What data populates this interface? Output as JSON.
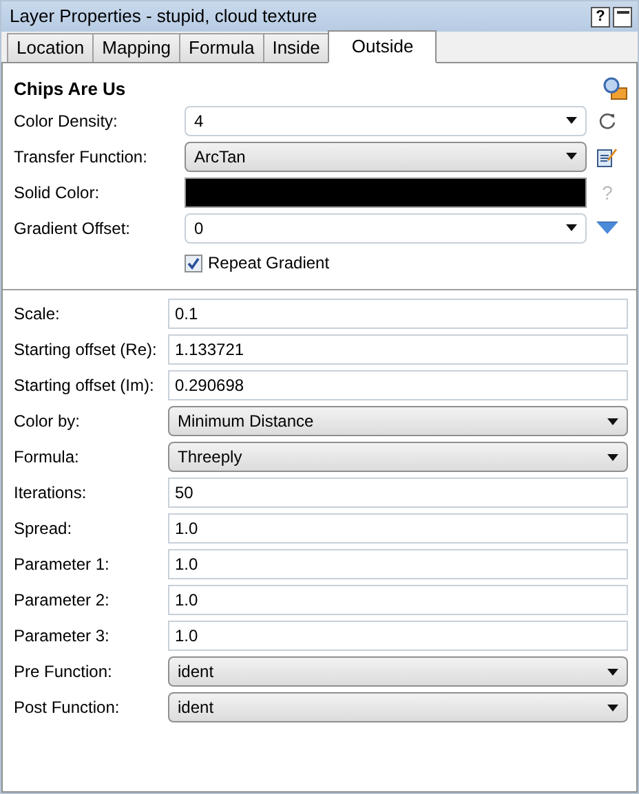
{
  "window": {
    "title": "Layer Properties - stupid, cloud texture",
    "help_button": "?"
  },
  "tabs": [
    {
      "label": "Location",
      "selected": false
    },
    {
      "label": "Mapping",
      "selected": false
    },
    {
      "label": "Formula",
      "selected": false
    },
    {
      "label": "Inside",
      "selected": false
    },
    {
      "label": "Outside",
      "selected": true
    }
  ],
  "section": {
    "title": "Chips Are Us"
  },
  "top_fields": [
    {
      "label": "Color Density:",
      "kind": "combo",
      "value": "4",
      "side_button": {
        "kind": "reset"
      }
    },
    {
      "label": "Transfer Function:",
      "kind": "select",
      "value": "ArcTan",
      "side_button": {
        "kind": "edit"
      }
    },
    {
      "label": "Solid Color:",
      "kind": "color",
      "color": "#000000",
      "side_button": {
        "kind": "help",
        "label": "?"
      }
    },
    {
      "label": "Gradient Offset:",
      "kind": "combo",
      "value": "0",
      "side_button": {
        "kind": "triangle"
      }
    }
  ],
  "repeat_gradient": {
    "label": "Repeat Gradient",
    "checked": true
  },
  "params": [
    {
      "label": "Scale:",
      "kind": "text",
      "value": "0.1"
    },
    {
      "label": "Starting offset (Re):",
      "kind": "text",
      "value": "1.133721"
    },
    {
      "label": "Starting offset (Im):",
      "kind": "text",
      "value": "0.290698"
    },
    {
      "label": "Color by:",
      "kind": "select",
      "value": "Minimum Distance"
    },
    {
      "label": "Formula:",
      "kind": "select",
      "value": "Threeply"
    },
    {
      "label": "Iterations:",
      "kind": "text",
      "value": "50"
    },
    {
      "label": "Spread:",
      "kind": "text",
      "value": "1.0"
    },
    {
      "label": "Parameter 1:",
      "kind": "text",
      "value": "1.0"
    },
    {
      "label": "Parameter 2:",
      "kind": "text",
      "value": "1.0"
    },
    {
      "label": "Parameter 3:",
      "kind": "text",
      "value": "1.0"
    },
    {
      "label": "Pre Function:",
      "kind": "select",
      "value": "ident"
    },
    {
      "label": "Post Function:",
      "kind": "select",
      "value": "ident"
    }
  ]
}
